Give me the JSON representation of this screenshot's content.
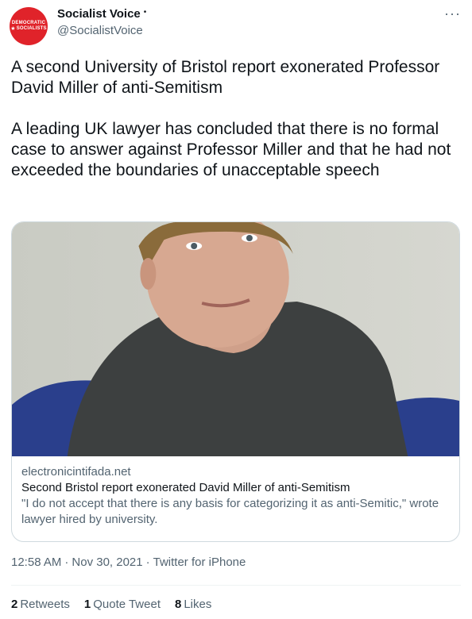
{
  "author": {
    "avatar_text_line1": "DEMOCRATIC",
    "avatar_text_line2": "SOCIALISTS",
    "avatar_color": "#e0232a",
    "display_name": "Socialist Voice",
    "name_suffix": "•",
    "handle": "@SocialistVoice",
    "more_icon": "more-horizontal-icon"
  },
  "tweet": {
    "paragraph1": "A second University of Bristol report exonerated Professor David Miller of anti-Semitism",
    "paragraph2": "A leading UK lawyer has concluded that there is no formal case to answer against Professor Miller and that he had not exceeded the boundaries of unacceptable speech"
  },
  "card": {
    "domain": "electronicintifada.net",
    "title": "Second Bristol report exonerated David Miller of anti-Semitism",
    "description": "\"I do not accept that there is any basis for categorizing it as anti-Semitic,\" wrote lawyer hired by university."
  },
  "meta": {
    "time": "12:58 AM",
    "date": "Nov 30, 2021",
    "source": "Twitter for iPhone",
    "separator": "·"
  },
  "stats": {
    "retweets_count": "2",
    "retweets_label": "Retweets",
    "quotes_count": "1",
    "quotes_label": "Quote Tweet",
    "likes_count": "8",
    "likes_label": "Likes"
  }
}
